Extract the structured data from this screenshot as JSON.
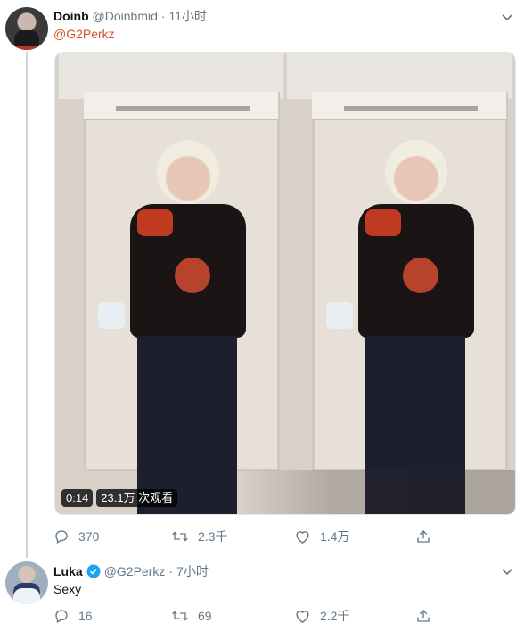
{
  "tweet": {
    "name": "Doinb",
    "handle": "@Doinbmid",
    "separator": "·",
    "time": "11小时",
    "mention": "@G2Perkz",
    "video": {
      "duration": "0:14",
      "views": "23.1万 次观看"
    },
    "stats": {
      "reply": "370",
      "retweet": "2.3千",
      "like": "1.4万"
    }
  },
  "reply": {
    "name": "Luka",
    "handle": "@G2Perkz",
    "separator": "·",
    "time": "7小时",
    "text": "Sexy",
    "stats": {
      "reply": "16",
      "retweet": "69",
      "like": "2.2千"
    }
  },
  "icons": [
    "chevron-down-icon",
    "reply-icon",
    "retweet-icon",
    "like-icon",
    "share-icon",
    "verified-badge-icon"
  ],
  "colors": {
    "mention": "#d6502a",
    "verified": "#1da1f2",
    "muted": "#657786",
    "thread": "#ccd6dd"
  }
}
